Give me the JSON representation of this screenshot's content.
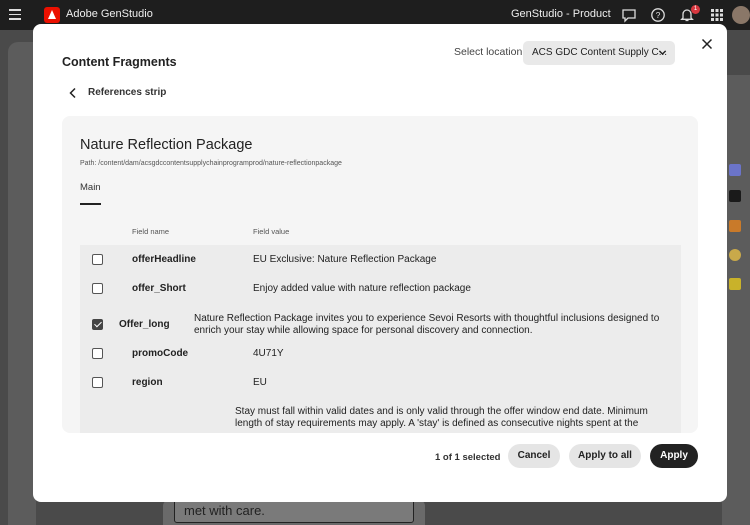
{
  "topbar": {
    "app_title": "Adobe GenStudio",
    "product_title": "GenStudio - Product",
    "notification_count": "1",
    "icons": [
      "menu-icon",
      "adobe-logo-icon",
      "feedback-icon",
      "help-icon",
      "bell-icon",
      "apps-grid-icon",
      "avatar"
    ]
  },
  "background": {
    "snippet_text": "met with care."
  },
  "modal": {
    "title": "Content Fragments",
    "location_label": "Select location",
    "location_value": "ACS GDC Content Supply C...",
    "back_label": "References strip",
    "fragment_title": "Nature Reflection Package",
    "fragment_path": "Path: /content/dam/acsgdccontentsupplychainprogramprod/nature-reflectionpackage",
    "tab_main": "Main",
    "columns": {
      "field_name": "Field name",
      "field_value": "Field value"
    },
    "rows": [
      {
        "name": "offerHeadline",
        "value": "EU Exclusive: Nature Reflection Package",
        "checked": false
      },
      {
        "name": "offer_Short",
        "value": "Enjoy added value with nature reflection package",
        "checked": false
      },
      {
        "name": "Offer_long",
        "value": "Nature Reflection Package invites you to experience Sevoi Resorts with thoughtful inclusions designed to enrich your stay while allowing space for personal discovery and connection.",
        "checked": true
      },
      {
        "name": "promoCode",
        "value": "4U71Y",
        "checked": false
      },
      {
        "name": "region",
        "value": "EU",
        "checked": false
      },
      {
        "name": "",
        "value": "Stay must fall within valid dates and is only valid through the offer window end date. Minimum length of stay requirements may apply. A 'stay' is defined as consecutive nights spent at the",
        "checked": false
      }
    ],
    "footer": {
      "selected_count": "1 of 1 selected",
      "cancel_label": "Cancel",
      "apply_all_label": "Apply to all",
      "apply_label": "Apply"
    }
  }
}
